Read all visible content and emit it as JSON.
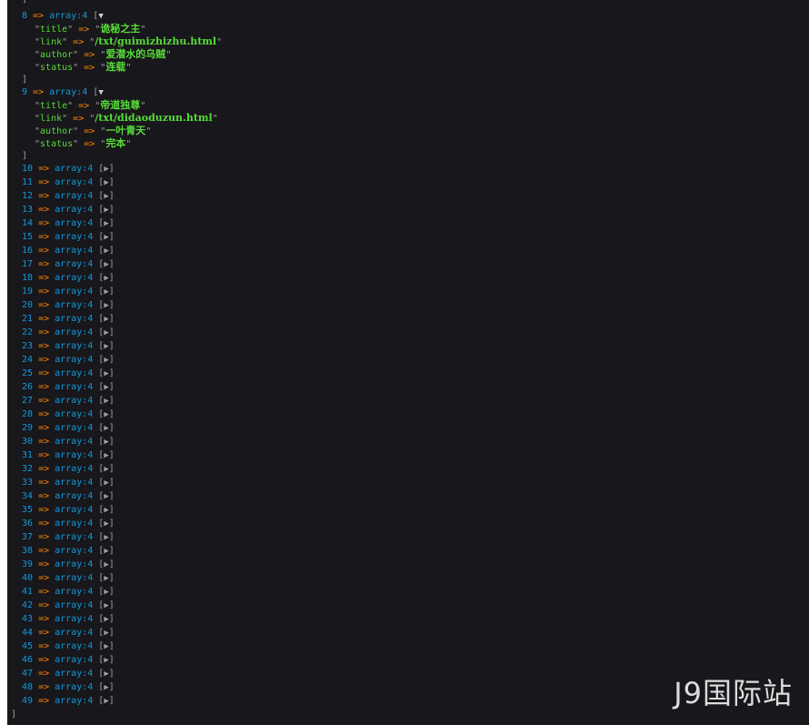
{
  "arrow": "=>",
  "type_label": "array:4",
  "expanded_glyph": "▼",
  "collapsed_glyph": "▶",
  "top_close": "]",
  "bottom_close": "]",
  "expanded_items": [
    {
      "index": "8",
      "fields": [
        {
          "key": "title",
          "value": "诡秘之主"
        },
        {
          "key": "link",
          "value": "/txt/guimizhizhu.html"
        },
        {
          "key": "author",
          "value": "爱潜水的乌贼"
        },
        {
          "key": "status",
          "value": "连载"
        }
      ]
    },
    {
      "index": "9",
      "fields": [
        {
          "key": "title",
          "value": "帝道独尊"
        },
        {
          "key": "link",
          "value": "/txt/didaoduzun.html"
        },
        {
          "key": "author",
          "value": "一叶青天"
        },
        {
          "key": "status",
          "value": "完本"
        }
      ]
    }
  ],
  "collapsed_indices": [
    "10",
    "11",
    "12",
    "13",
    "14",
    "15",
    "16",
    "17",
    "18",
    "19",
    "20",
    "21",
    "22",
    "23",
    "24",
    "25",
    "26",
    "27",
    "28",
    "29",
    "30",
    "31",
    "32",
    "33",
    "34",
    "35",
    "36",
    "37",
    "38",
    "39",
    "40",
    "41",
    "42",
    "43",
    "44",
    "45",
    "46",
    "47",
    "48",
    "49"
  ],
  "watermark": "J9国际站"
}
